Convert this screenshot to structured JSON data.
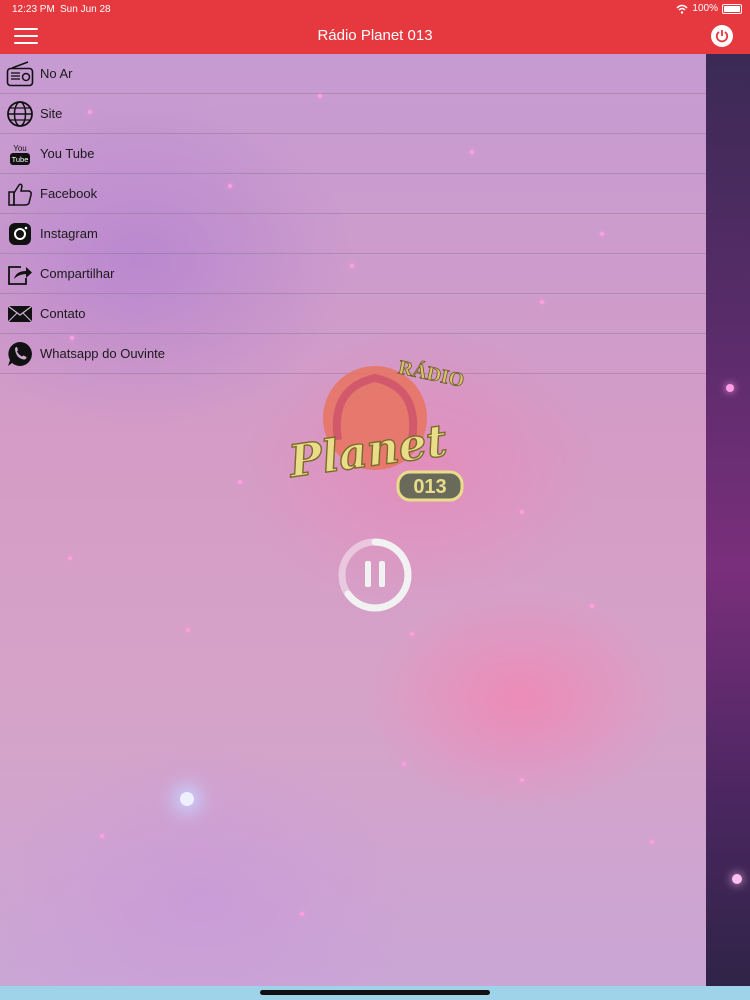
{
  "status_bar": {
    "time": "12:23 PM",
    "date": "Sun Jun 28",
    "battery": "100%"
  },
  "header": {
    "title": "Rádio Planet 013"
  },
  "menu": {
    "items": [
      {
        "label": "No Ar",
        "icon": "radio-icon"
      },
      {
        "label": "Site",
        "icon": "globe-icon"
      },
      {
        "label": "You Tube",
        "icon": "youtube-icon"
      },
      {
        "label": "Facebook",
        "icon": "thumbs-up-icon"
      },
      {
        "label": "Instagram",
        "icon": "instagram-icon"
      },
      {
        "label": "Compartilhar",
        "icon": "share-icon"
      },
      {
        "label": "Contato",
        "icon": "envelope-icon"
      },
      {
        "label": "Whatsapp do Ouvinte",
        "icon": "whatsapp-icon"
      }
    ]
  },
  "logo": {
    "top_text": "RÁDIO",
    "main_text": "Planet",
    "badge_text": "013"
  },
  "player": {
    "state": "playing",
    "control": "pause"
  },
  "colors": {
    "accent": "#e5393f"
  }
}
